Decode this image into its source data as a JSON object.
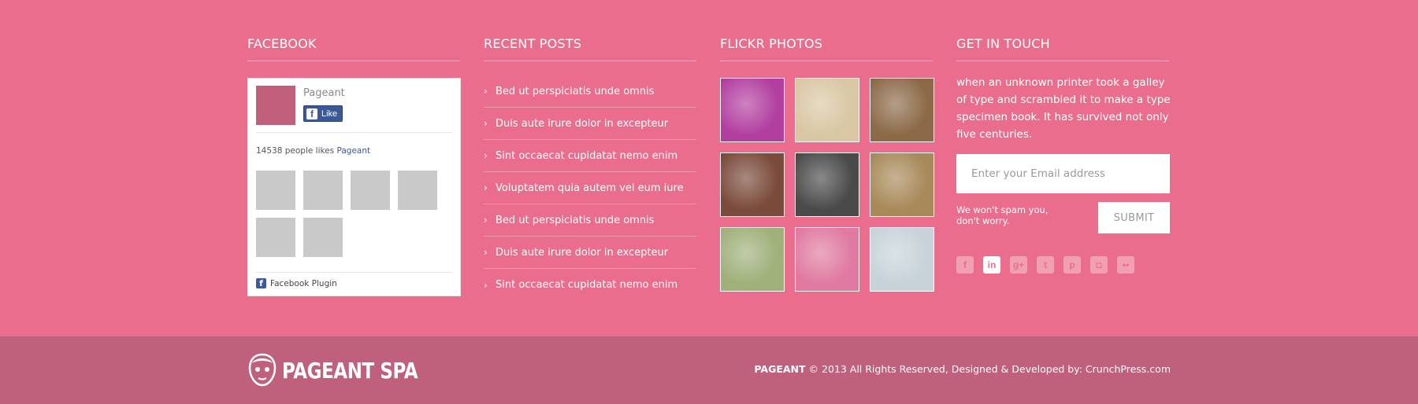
{
  "facebook": {
    "title": "FACEBOOK",
    "page_name": "Pageant",
    "like_label": "Like",
    "likes_prefix": "14538 people likes",
    "likes_link": "Pageant",
    "plugin_label": "Facebook Plugin",
    "face_count": 6
  },
  "recent_posts": {
    "title": "RECENT POSTS",
    "items": [
      "Bed ut perspiciatis unde omnis",
      "Duis aute irure dolor in excepteur",
      "Sint occaecat cupidatat nemo enim",
      "Voluptatem quia autem vel eum iure",
      "Bed ut perspiciatis unde omnis",
      "Duis aute irure dolor in excepteur",
      "Sint occaecat cupidatat nemo enim"
    ]
  },
  "flickr": {
    "title": "FLICKR PHOTOS",
    "photos": [
      {
        "name": "orchid-hands-photo",
        "color": "#b23fa0"
      },
      {
        "name": "foot-spa-photo",
        "color": "#d9c7a3"
      },
      {
        "name": "spa-bowl-photo",
        "color": "#8c6a48"
      },
      {
        "name": "facial-mask-photo",
        "color": "#7a4a3a"
      },
      {
        "name": "stretching-photo",
        "color": "#4a4a4a"
      },
      {
        "name": "spa-pool-photo",
        "color": "#a88a5a"
      },
      {
        "name": "yoga-woman-photo",
        "color": "#9fb07a"
      },
      {
        "name": "fitness-woman-photo",
        "color": "#e07aa0"
      },
      {
        "name": "meditation-photo",
        "color": "#c7d3d9"
      }
    ]
  },
  "contact": {
    "title": "GET IN TOUCH",
    "text": "when an unknown printer took a galley of type and scrambled it to make a type specimen book. It has survived not only five centuries.",
    "email_placeholder": "Enter your Email address",
    "spam_note": "We won't spam you, don't worry.",
    "submit_label": "SUBMIT",
    "socials": [
      {
        "name": "facebook-icon",
        "glyph": "f",
        "active": false
      },
      {
        "name": "linkedin-icon",
        "glyph": "in",
        "active": true
      },
      {
        "name": "google-plus-icon",
        "glyph": "g+",
        "active": false
      },
      {
        "name": "twitter-icon",
        "glyph": "t",
        "active": false
      },
      {
        "name": "pinterest-icon",
        "glyph": "p",
        "active": false
      },
      {
        "name": "instagram-icon",
        "glyph": "◘",
        "active": false
      },
      {
        "name": "flickr-icon",
        "glyph": "••",
        "active": false
      }
    ]
  },
  "bottom": {
    "brand": "PAGEANT SPA",
    "copyright_brand": "PAGEANT",
    "copyright_text": " © 2013 All Rights Reserved, Designed & Developed by: CrunchPress.com"
  },
  "colors": {
    "background": "#ea6d8d",
    "bottom_bar": "#bf617d",
    "facebook_blue": "#3b5998"
  }
}
